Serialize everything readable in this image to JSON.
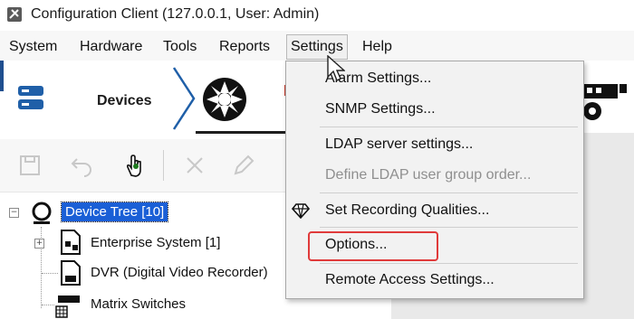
{
  "window": {
    "title": "Configuration Client (127.0.0.1, User: Admin)"
  },
  "menubar": {
    "items": [
      "System",
      "Hardware",
      "Tools",
      "Reports",
      "Settings",
      "Help"
    ],
    "active": "Settings"
  },
  "nav": {
    "devices_label": "Devices"
  },
  "tree": {
    "root": "Device Tree [10]",
    "items": [
      "Enterprise System [1]",
      "DVR (Digital Video Recorder)",
      "Matrix Switches"
    ]
  },
  "settings_menu": {
    "items": [
      {
        "label": "Alarm Settings...",
        "enabled": true
      },
      {
        "label": "SNMP Settings...",
        "enabled": true
      },
      {
        "label": "LDAP server settings...",
        "enabled": true
      },
      {
        "label": "Define LDAP user group order...",
        "enabled": false
      },
      {
        "label": "Set Recording Qualities...",
        "enabled": true
      },
      {
        "label": "Options...",
        "enabled": true,
        "highlighted": true
      },
      {
        "label": "Remote Access Settings...",
        "enabled": true
      }
    ]
  },
  "colors": {
    "selection": "#1a5fd6",
    "highlight_box": "#e03a3a",
    "toolbar_active": "#1e7a1e",
    "accent": "#1f4f8f"
  }
}
